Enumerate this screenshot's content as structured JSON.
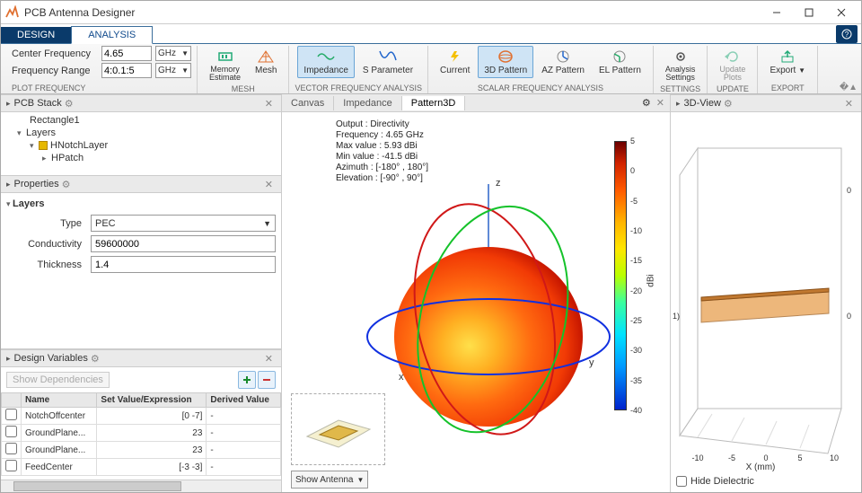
{
  "window": {
    "title": "PCB Antenna Designer"
  },
  "tabs": {
    "design": "DESIGN",
    "analysis": "ANALYSIS"
  },
  "freq": {
    "center_label": "Center Frequency",
    "center_val": "4.65",
    "center_unit": "GHz",
    "range_label": "Frequency Range",
    "range_val": "4:0.1:5",
    "range_unit": "GHz",
    "group": "PLOT FREQUENCY"
  },
  "tool": {
    "memory": "Memory\nEstimate",
    "mesh": "Mesh",
    "mesh_group": "MESH",
    "imp": "Impedance",
    "sparam": "S Parameter",
    "vfa_group": "VECTOR FREQUENCY ANALYSIS",
    "current": "Current",
    "pat3d": "3D Pattern",
    "azpat": "AZ Pattern",
    "elpat": "EL Pattern",
    "sfa_group": "SCALAR FREQUENCY ANALYSIS",
    "settings": "Analysis\nSettings",
    "settings_group": "SETTINGS",
    "update": "Update\nPlots",
    "update_group": "UPDATE",
    "export": "Export",
    "export_group": "EXPORT"
  },
  "pcbstack": {
    "title": "PCB Stack",
    "rect": "Rectangle1",
    "layers": "Layers",
    "hnotch": "HNotchLayer",
    "hpatch": "HPatch"
  },
  "props": {
    "title": "Properties",
    "layers_hdr": "Layers",
    "type_label": "Type",
    "type_val": "PEC",
    "cond_label": "Conductivity",
    "cond_val": "59600000",
    "thick_label": "Thickness",
    "thick_val": "1.4"
  },
  "dvars": {
    "title": "Design Variables",
    "showdep": "Show Dependencies",
    "cols": {
      "name": "Name",
      "set": "Set Value/Expression",
      "derived": "Derived Value"
    },
    "rows": [
      {
        "name": "NotchOffcenter",
        "set": "[0 -7]",
        "der": "-"
      },
      {
        "name": "GroundPlane...",
        "set": "23",
        "der": "-"
      },
      {
        "name": "GroundPlane...",
        "set": "23",
        "der": "-"
      },
      {
        "name": "FeedCenter",
        "set": "[-3 -3]",
        "der": "-"
      }
    ]
  },
  "midtabs": {
    "canvas": "Canvas",
    "imp": "Impedance",
    "pat3d": "Pattern3D"
  },
  "info": {
    "l1": "Output : Directivity",
    "l2": "Frequency : 4.65 GHz",
    "l3": "Max value : 5.93 dBi",
    "l4": "Min value : -41.5 dBi",
    "l5": "Azimuth : [-180° , 180°]",
    "l6": "Elevation : [-90° , 90°]"
  },
  "axes": {
    "x": "x",
    "y": "y",
    "z": "z"
  },
  "colorbar": {
    "unit": "dBi",
    "ticks": [
      "5",
      "0",
      "-5",
      "-10",
      "-15",
      "-20",
      "-25",
      "-30",
      "-35",
      "-40"
    ]
  },
  "showant": "Show Antenna",
  "right": {
    "title": "3D-View",
    "xlabel": "X (mm)",
    "xticks": [
      "-10",
      "-5",
      "0",
      "5",
      "10"
    ],
    "hide": "Hide Dielectric"
  },
  "chart_data": {
    "type": "heatmap",
    "title": "3D Directivity Pattern",
    "frequency_GHz": 4.65,
    "output": "Directivity",
    "max_dBi": 5.93,
    "min_dBi": -41.5,
    "azimuth_range_deg": [
      -180,
      180
    ],
    "elevation_range_deg": [
      -90,
      90
    ],
    "colorbar_unit": "dBi",
    "colorbar_range": [
      -40,
      5
    ]
  }
}
